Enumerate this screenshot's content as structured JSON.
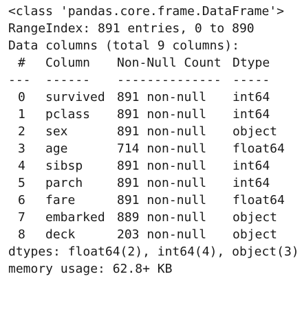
{
  "info": {
    "class_line": "<class 'pandas.core.frame.DataFrame'>",
    "range_index": "RangeIndex: 891 entries, 0 to 890",
    "data_columns": "Data columns (total 9 columns):",
    "header": {
      "idx": "#",
      "column": "Column",
      "count": "Non-Null Count",
      "dtype": "Dtype"
    },
    "separator": {
      "idx": "---",
      "column": "------",
      "count": "--------------",
      "dtype": "-----"
    },
    "rows": [
      {
        "idx": "0",
        "column": "survived",
        "count": "891 non-null",
        "dtype": "int64"
      },
      {
        "idx": "1",
        "column": "pclass",
        "count": "891 non-null",
        "dtype": "int64"
      },
      {
        "idx": "2",
        "column": "sex",
        "count": "891 non-null",
        "dtype": "object"
      },
      {
        "idx": "3",
        "column": "age",
        "count": "714 non-null",
        "dtype": "float64"
      },
      {
        "idx": "4",
        "column": "sibsp",
        "count": "891 non-null",
        "dtype": "int64"
      },
      {
        "idx": "5",
        "column": "parch",
        "count": "891 non-null",
        "dtype": "int64"
      },
      {
        "idx": "6",
        "column": "fare",
        "count": "891 non-null",
        "dtype": "float64"
      },
      {
        "idx": "7",
        "column": "embarked",
        "count": "889 non-null",
        "dtype": "object"
      },
      {
        "idx": "8",
        "column": "deck",
        "count": "203 non-null",
        "dtype": "object"
      }
    ],
    "dtypes_line": "dtypes: float64(2), int64(4), object(3)",
    "memory_line": "memory usage: 62.8+ KB"
  }
}
